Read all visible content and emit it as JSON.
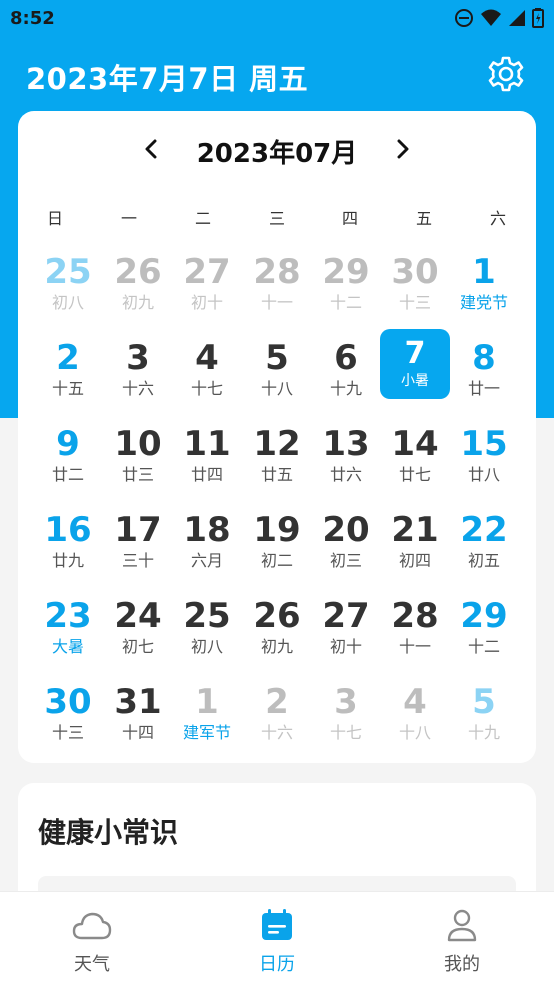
{
  "status_bar": {
    "time": "8:52"
  },
  "header": {
    "title": "2023年7月7日 周五",
    "settings_icon": "gear-icon"
  },
  "calendar": {
    "month_title": "2023年07月",
    "prev_icon": "chevron-left-icon",
    "next_icon": "chevron-right-icon",
    "weekdays": [
      "日",
      "一",
      "二",
      "三",
      "四",
      "五",
      "六"
    ],
    "weeks": [
      [
        {
          "n": "25",
          "s": "初八",
          "other": true
        },
        {
          "n": "26",
          "s": "初九",
          "other": true
        },
        {
          "n": "27",
          "s": "初十",
          "other": true
        },
        {
          "n": "28",
          "s": "十一",
          "other": true
        },
        {
          "n": "29",
          "s": "十二",
          "other": true
        },
        {
          "n": "30",
          "s": "十三",
          "other": true
        },
        {
          "n": "1",
          "s": "建党节",
          "festival": true
        }
      ],
      [
        {
          "n": "2",
          "s": "十五"
        },
        {
          "n": "3",
          "s": "十六"
        },
        {
          "n": "4",
          "s": "十七"
        },
        {
          "n": "5",
          "s": "十八"
        },
        {
          "n": "6",
          "s": "十九"
        },
        {
          "n": "7",
          "s": "小暑",
          "selected": true
        },
        {
          "n": "8",
          "s": "廿一"
        }
      ],
      [
        {
          "n": "9",
          "s": "廿二"
        },
        {
          "n": "10",
          "s": "廿三"
        },
        {
          "n": "11",
          "s": "廿四"
        },
        {
          "n": "12",
          "s": "廿五"
        },
        {
          "n": "13",
          "s": "廿六"
        },
        {
          "n": "14",
          "s": "廿七"
        },
        {
          "n": "15",
          "s": "廿八"
        }
      ],
      [
        {
          "n": "16",
          "s": "廿九"
        },
        {
          "n": "17",
          "s": "三十"
        },
        {
          "n": "18",
          "s": "六月"
        },
        {
          "n": "19",
          "s": "初二"
        },
        {
          "n": "20",
          "s": "初三"
        },
        {
          "n": "21",
          "s": "初四"
        },
        {
          "n": "22",
          "s": "初五"
        }
      ],
      [
        {
          "n": "23",
          "s": "大暑",
          "festival": true
        },
        {
          "n": "24",
          "s": "初七"
        },
        {
          "n": "25",
          "s": "初八"
        },
        {
          "n": "26",
          "s": "初九"
        },
        {
          "n": "27",
          "s": "初十"
        },
        {
          "n": "28",
          "s": "十一"
        },
        {
          "n": "29",
          "s": "十二"
        }
      ],
      [
        {
          "n": "30",
          "s": "十三"
        },
        {
          "n": "31",
          "s": "十四"
        },
        {
          "n": "1",
          "s": "建军节",
          "other": true,
          "festival": true
        },
        {
          "n": "2",
          "s": "十六",
          "other": true
        },
        {
          "n": "3",
          "s": "十七",
          "other": true
        },
        {
          "n": "4",
          "s": "十八",
          "other": true
        },
        {
          "n": "5",
          "s": "十九",
          "other": true
        }
      ]
    ]
  },
  "health": {
    "title": "健康小常识"
  },
  "bottom_nav": {
    "tabs": [
      {
        "label": "天气",
        "icon": "cloud-icon"
      },
      {
        "label": "日历",
        "icon": "calendar-icon",
        "active": true
      },
      {
        "label": "我的",
        "icon": "user-icon"
      }
    ]
  },
  "colors": {
    "primary": "#06a7ef",
    "accent_text": "#0aa3ea"
  }
}
